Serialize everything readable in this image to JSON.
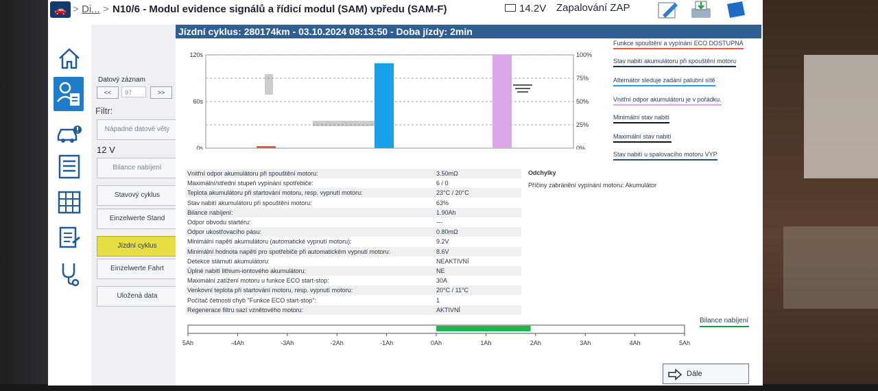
{
  "header": {
    "breadcrumb_sep1": ">",
    "breadcrumb_prev": "Di...",
    "breadcrumb_sep2": ">",
    "title": "N10/6 - Modul evidence signálů a řídicí modul (SAM) vpředu (SAM-F)",
    "battery_voltage": "14.2V",
    "ignition": "Zapalování ZAP"
  },
  "sidebar": {
    "record_label": "Datový záznam",
    "prev_label": "<<",
    "record_value": "97",
    "next_label": ">>",
    "filter_label": "Filtr:",
    "filter_button": "Nápadné datové věty",
    "voltage_label": "12 V",
    "buttons": [
      "Bilance nabíjení",
      "Stavový cyklus",
      "Einzelwerte Stand",
      "Jízdní cyklus",
      "Einzelwerte Fahrt",
      "Uložená data"
    ]
  },
  "main": {
    "title": "Jízdní cyklus: 280174km - 03.10.2024 08:13:50 - Doba jízdy: 2min"
  },
  "chart_data": [
    {
      "type": "bar",
      "y_left_ticks": [
        "0s",
        "60s",
        "120s"
      ],
      "y_right_ticks": [
        "0%",
        "25%",
        "50%",
        "75%",
        "100%"
      ],
      "ylim_left": [
        0,
        120
      ],
      "ylim_right": [
        0,
        100
      ],
      "grid": true,
      "series": [
        {
          "name": "Funkce spouštění a vypínání ECO DOSTUPNÁ",
          "values": [
            2
          ],
          "color": "#e8593a"
        },
        {
          "name": "Stav nabití akumulátoru při spouštění motoru",
          "values": [
            null
          ],
          "color": "#1e2c44"
        },
        {
          "name": "Alternátor sleduje zadání palubní sítě",
          "values": [
            91
          ],
          "color": "#17a1e8"
        },
        {
          "name": "Vnitřní odpor akumulátoru je v pořádku.",
          "values": [
            100
          ],
          "color": "#dba7e8"
        },
        {
          "name": "Minimální stav nabití",
          "values": [
            null
          ],
          "color": "#111111"
        },
        {
          "name": "Maximální stav nabití",
          "values": [
            null
          ],
          "color": "#111111"
        },
        {
          "name": "Stav nabití u spalovacího motoru VYP",
          "values": [
            null
          ],
          "color": "#2e4c6e"
        }
      ]
    },
    {
      "type": "bar",
      "title": "Bilance nabíjení",
      "x_ticks": [
        "5Ah",
        "-4Ah",
        "-3Ah",
        "-2Ah",
        "-1Ah",
        "0Ah",
        "1Ah",
        "2Ah",
        "3Ah",
        "4Ah",
        "5Ah"
      ],
      "xlim": [
        -5,
        5
      ],
      "values": [
        1.9
      ],
      "color": "#1fb54a"
    }
  ],
  "table": [
    [
      "Vnitřní odpor akumulátoru při spouštění motoru:",
      "3.50mΩ"
    ],
    [
      "Maximální/střední stupeň vypínání spotřebiče:",
      "6 / 0"
    ],
    [
      "Teplota akumulátoru při startování motoru, resp. vypnutí motoru:",
      "23°C / 20°C"
    ],
    [
      "Stav nabití akumulátoru při spouštění motoru:",
      "63%"
    ],
    [
      "Bilance nabíjení:",
      "1.90Ah"
    ],
    [
      "Odpor obvodu startéru:",
      "---"
    ],
    [
      "Odpor ukostřovacího pásu:",
      "0.80mΩ"
    ],
    [
      "Minimální napětí akumulátoru (automatické vypnutí motoru):",
      "9.2V"
    ],
    [
      "Minimální hodnota napětí pro spotřebiče při automatickém vypnutí motoru:",
      "8.6V"
    ],
    [
      "Detekce stárnutí akumulátoru:",
      "NEAKTIVNÍ"
    ],
    [
      "Úplné nabití lithium-iontového akumulátoru:",
      "NE"
    ],
    [
      "Maximální zatížení motoru u funkce ECO start-stop:",
      "30A"
    ],
    [
      "Venkovní teplota při startování motoru, resp. vypnutí motoru:",
      "20°C / 11°C"
    ],
    [
      "Počítač četnosti chyb \"Funkce ECO start-stop\":",
      "1"
    ],
    [
      "Regenerace filtru sazí vznětového motoru:",
      "AKTIVNÍ"
    ]
  ],
  "deviations": {
    "title": "Odchylky",
    "text": "Příčiny zabránění vypínání motoru: Akumulátor"
  },
  "footer": {
    "next_button": "Dále"
  }
}
